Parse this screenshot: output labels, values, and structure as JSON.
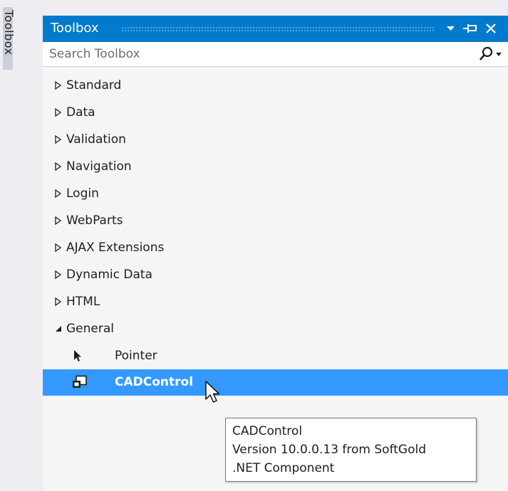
{
  "side_tab": {
    "label": "Toolbox"
  },
  "panel": {
    "title": "Toolbox",
    "search": {
      "placeholder": "Search Toolbox",
      "value": ""
    },
    "buttons": [
      "dropdown-arrow-icon",
      "pin-icon",
      "close-icon"
    ]
  },
  "categories": [
    {
      "label": "Standard",
      "expanded": false
    },
    {
      "label": "Data",
      "expanded": false
    },
    {
      "label": "Validation",
      "expanded": false
    },
    {
      "label": "Navigation",
      "expanded": false
    },
    {
      "label": "Login",
      "expanded": false
    },
    {
      "label": "WebParts",
      "expanded": false
    },
    {
      "label": "AJAX Extensions",
      "expanded": false
    },
    {
      "label": "Dynamic Data",
      "expanded": false
    },
    {
      "label": "HTML",
      "expanded": false
    },
    {
      "label": "General",
      "expanded": true
    }
  ],
  "general_items": [
    {
      "label": "Pointer",
      "icon": "pointer-icon",
      "selected": false
    },
    {
      "label": "CADControl",
      "icon": "component-icon",
      "selected": true
    }
  ],
  "tooltip": {
    "line1": "CADControl",
    "line2": "Version 10.0.0.13 from SoftGold",
    "line3": ".NET Component"
  },
  "colors": {
    "title_bar": "#007acc",
    "selection": "#3399ff",
    "panel_bg": "#f5f5f5"
  }
}
